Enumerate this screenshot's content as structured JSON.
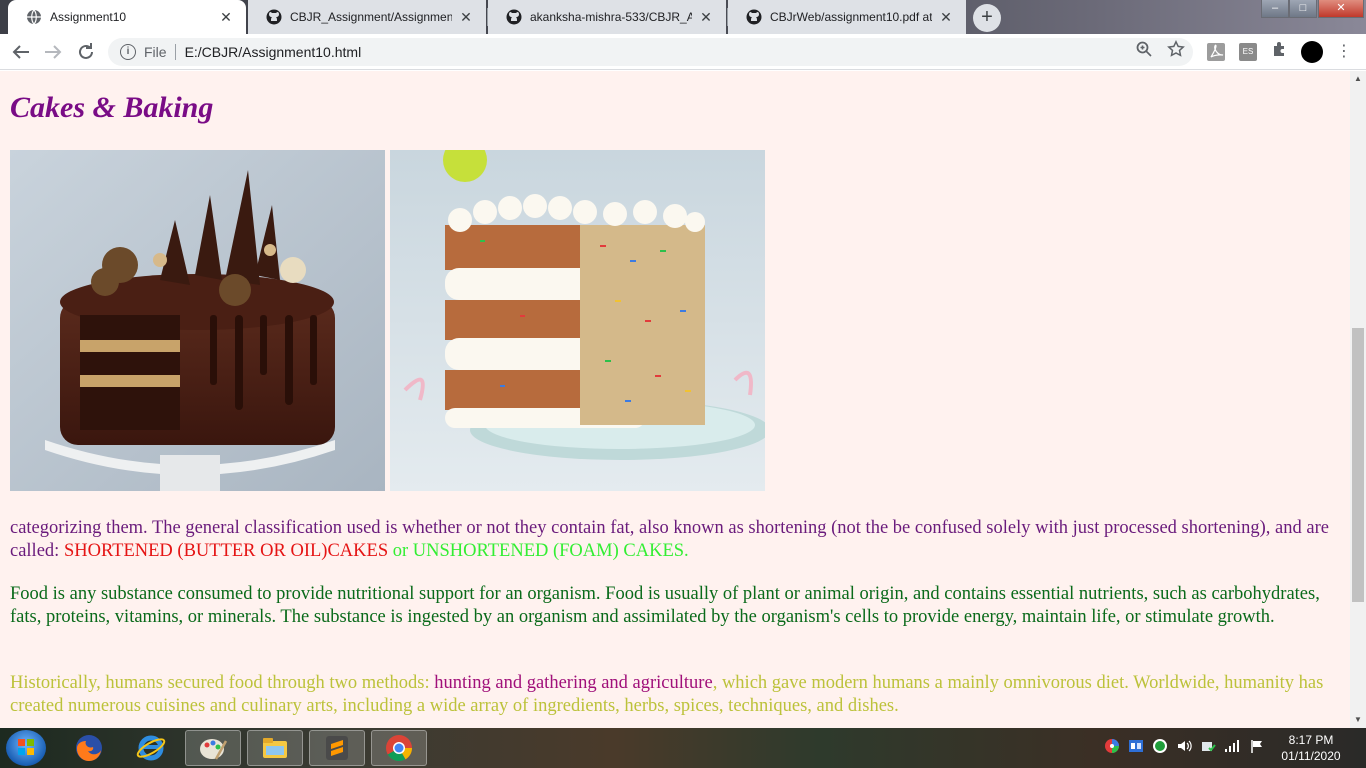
{
  "browser": {
    "tabs": [
      {
        "label": "Assignment10",
        "active": true,
        "favicon": "globe-icon"
      },
      {
        "label": "CBJR_Assignment/Assignment10",
        "active": false,
        "favicon": "github-icon"
      },
      {
        "label": "akanksha-mishra-533/CBJR_Assig",
        "active": false,
        "favicon": "github-icon"
      },
      {
        "label": "CBJrWeb/assignment10.pdf at m",
        "active": false,
        "favicon": "github-icon"
      }
    ],
    "tab_close": "✕",
    "new_tab": "+",
    "omnibox": {
      "scheme_label": "File",
      "url": "E:/CBJR/Assignment10.html"
    },
    "extensions": [
      {
        "name": "acrobat-extension-icon",
        "label": ""
      },
      {
        "name": "es-extension-icon",
        "label": "ES"
      }
    ]
  },
  "page": {
    "title": "Cakes & Baking",
    "paragraphs": {
      "p1": {
        "lead": "categorizing them. The general classification used is whether or not they contain fat, also known as shortening (not the be confused solely with just processed shortening), and are called: ",
        "red": "SHORTENED (BUTTER OR OIL)CAKES",
        "green": " or UNSHORTENED (FOAM) CAKES."
      },
      "p2": "Food is any substance consumed to provide nutritional support for an organism. Food is usually of plant or animal origin, and contains essential nutrients, such as carbohydrates, fats, proteins, vitamins, or minerals. The substance is ingested by an organism and assimilated by the organism's cells to provide energy, maintain life, or stimulate growth.",
      "p3": {
        "lead": "Historically, humans secured food through two methods: ",
        "purple": "hunting and gathering and agriculture",
        "tail": ", which gave modern humans a mainly omnivorous diet. Worldwide, humanity has created numerous cuisines and culinary arts, including a wide array of ingredients, herbs, spices, techniques, and dishes."
      }
    },
    "colors": {
      "background": "#fff2ef",
      "title": "#7a0c86",
      "p1": "#6a1b7c",
      "p1_red": "#e51414",
      "p1_green": "#33ee33",
      "p2": "#0a6a1a",
      "p3": "#bcc23a",
      "p3_purple": "#a0107a"
    }
  },
  "taskbar": {
    "time": "8:17 PM",
    "date": "01/11/2020",
    "apps": [
      "firefox-icon",
      "internet-explorer-icon",
      "paint-icon",
      "file-explorer-icon",
      "sublime-text-icon",
      "chrome-icon"
    ]
  }
}
